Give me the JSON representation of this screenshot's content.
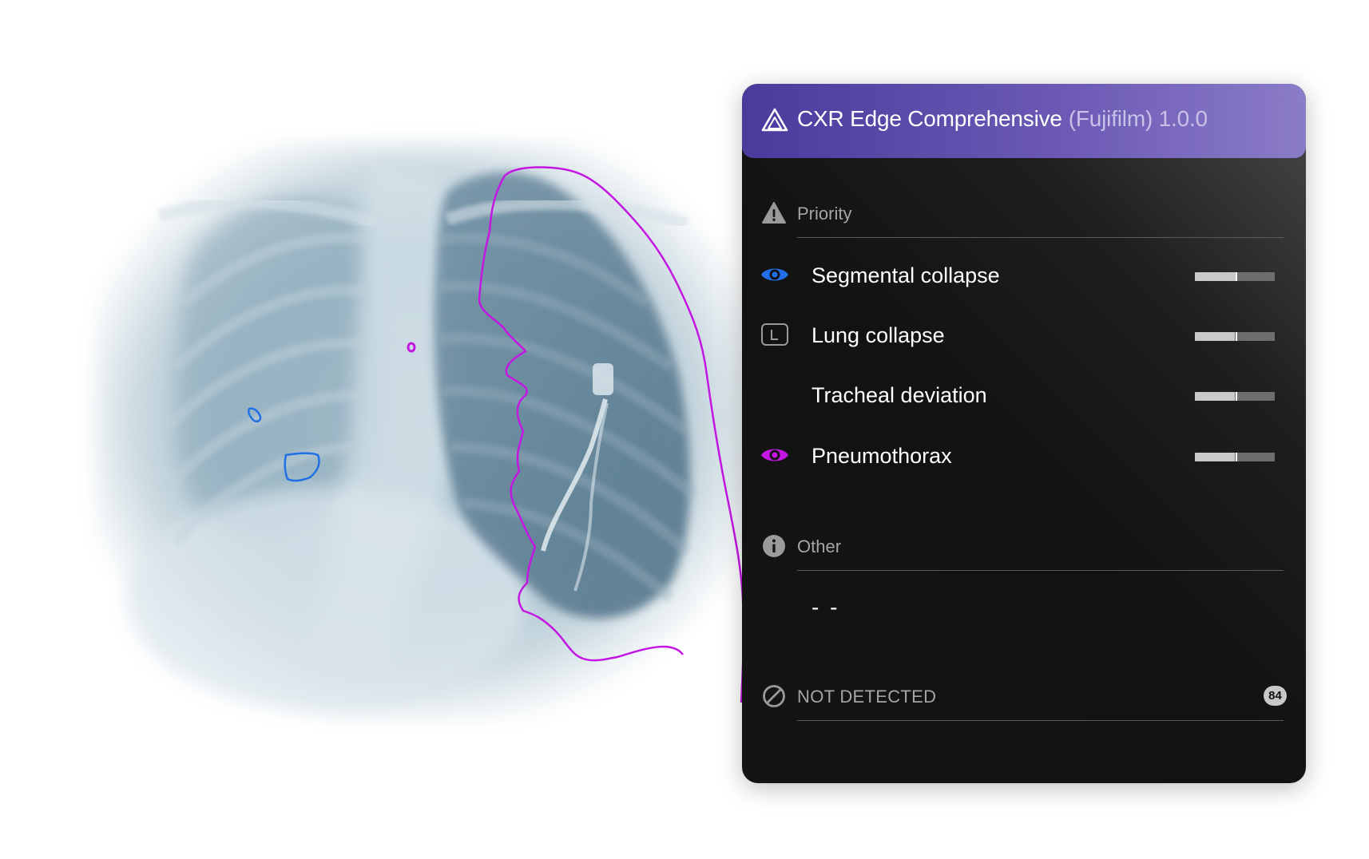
{
  "header": {
    "title": "CXR Edge Comprehensive",
    "vendor_version": "(Fujifilm) 1.0.0",
    "logo_icon": "triangle-logo-icon"
  },
  "sections": {
    "priority": {
      "label": "Priority",
      "icon": "warning-icon"
    },
    "other": {
      "label": "Other",
      "icon": "info-icon",
      "value": "- -"
    },
    "not_detected": {
      "label": "NOT DETECTED",
      "icon": "prohibited-icon",
      "count": "84"
    }
  },
  "findings": [
    {
      "label": "Segmental collapse",
      "icon": "eye-icon",
      "icon_color": "#1f6fe6",
      "score": 0.52
    },
    {
      "label": "Lung collapse",
      "icon": "l-box-icon",
      "icon_color": "#9a9a9a",
      "score": 0.5
    },
    {
      "label": "Tracheal deviation",
      "icon": "",
      "icon_color": "",
      "score": 0.5
    },
    {
      "label": "Pneumothorax",
      "icon": "eye-icon",
      "icon_color": "#c316e3",
      "score": 0.5
    }
  ],
  "overlay_colors": {
    "segmental_collapse": "#1f6fe6",
    "pneumothorax": "#c316e3"
  }
}
